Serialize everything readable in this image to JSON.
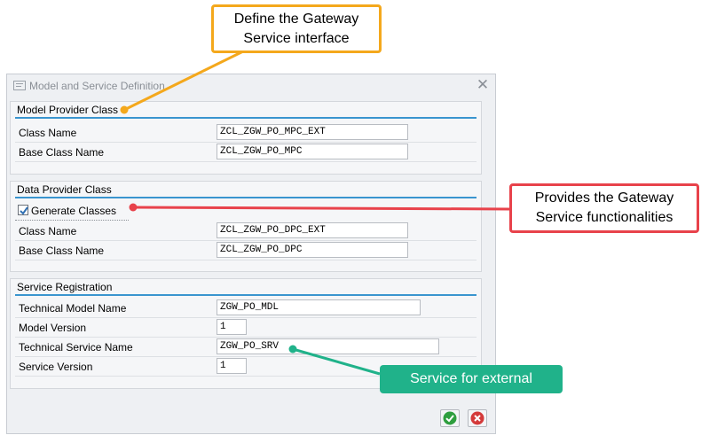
{
  "dialog": {
    "title": "Model and Service Definition",
    "close_glyph": "✕"
  },
  "model_provider": {
    "heading": "Model Provider Class",
    "class_name_label": "Class Name",
    "class_name_value": "ZCL_ZGW_PO_MPC_EXT",
    "base_class_label": "Base Class Name",
    "base_class_value": "ZCL_ZGW_PO_MPC"
  },
  "data_provider": {
    "heading": "Data Provider Class",
    "generate_label": "Generate Classes",
    "generate_checked": true,
    "class_name_label": "Class Name",
    "class_name_value": "ZCL_ZGW_PO_DPC_EXT",
    "base_class_label": "Base Class Name",
    "base_class_value": "ZCL_ZGW_PO_DPC"
  },
  "service_registration": {
    "heading": "Service Registration",
    "tech_model_label": "Technical Model Name",
    "tech_model_value": "ZGW_PO_MDL",
    "model_version_label": "Model Version",
    "model_version_value": "1",
    "tech_service_label": "Technical Service Name",
    "tech_service_value": "ZGW_PO_SRV",
    "service_version_label": "Service Version",
    "service_version_value": "1"
  },
  "buttons": {
    "ok_icon": "check-icon",
    "cancel_icon": "cancel-icon"
  },
  "callouts": {
    "define_line1": "Define the Gateway",
    "define_line2": "Service interface",
    "provides_line1": "Provides the Gateway",
    "provides_line2": "Service functionalities",
    "service": "Service for external"
  },
  "colors": {
    "yellow": "#f4a81c",
    "red": "#e8424b",
    "green": "#20b28a",
    "accent": "#3a95cf"
  }
}
